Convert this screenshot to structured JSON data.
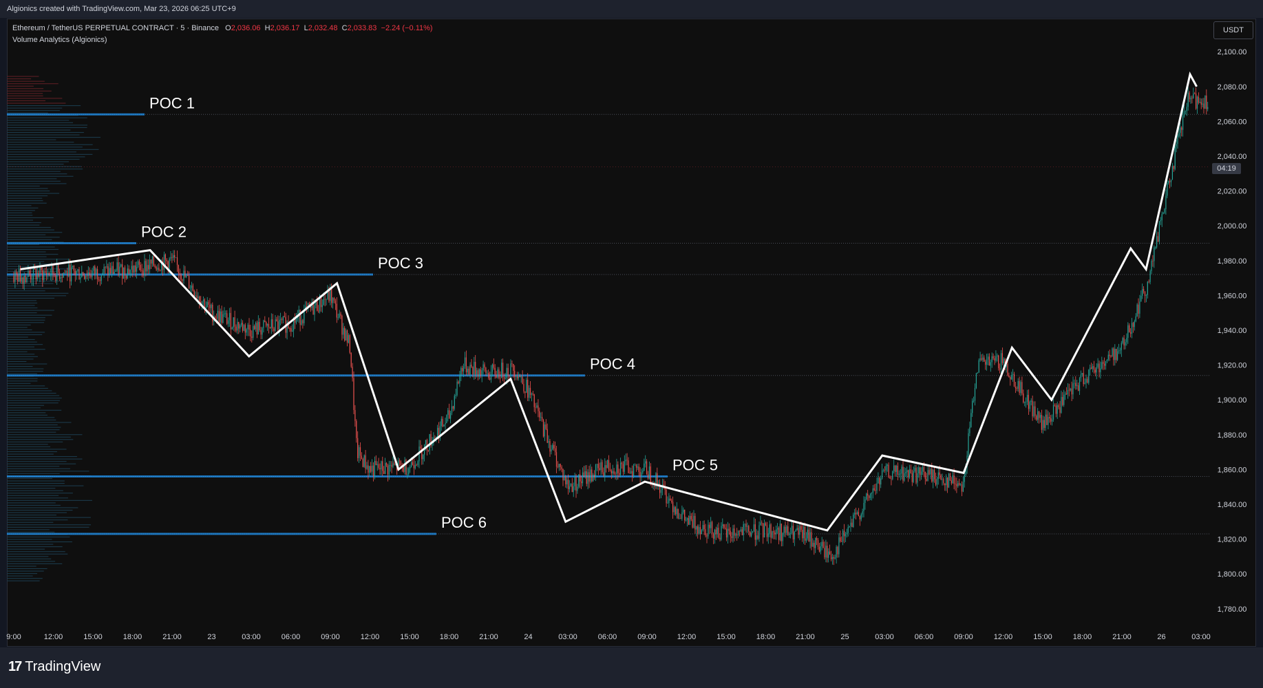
{
  "header": {
    "caption": "Algionics created with TradingView.com, Mar 23, 2026 06:25 UTC+9"
  },
  "legend": {
    "symbol": "Ethereum / TetherUS PERPETUAL CONTRACT · 5 · Binance",
    "o_label": "O",
    "o_value": "2,036.06",
    "h_label": "H",
    "h_value": "2,036.17",
    "l_label": "L",
    "l_value": "2,032.48",
    "c_label": "C",
    "c_value": "2,033.83",
    "change": "−2.24 (−0.11%)",
    "indicator": "Volume Analytics (Algionics)"
  },
  "currency_button": "USDT",
  "countdown": "04:19",
  "footer": {
    "brand": "TradingView",
    "logo_glyph": "17"
  },
  "colors": {
    "background": "#0f0f0f",
    "up": "#26a69a",
    "down": "#ef5350",
    "profile": "#2196f3",
    "zigzag": "#ffffff",
    "poc_line": "#2196f3"
  },
  "chart_data": {
    "type": "line",
    "title": "",
    "y_ticks": [
      "2,100.00",
      "2,080.00",
      "2,060.00",
      "2,040.00",
      "2,020.00",
      "2,000.00",
      "1,980.00",
      "1,960.00",
      "1,940.00",
      "1,920.00",
      "1,900.00",
      "1,880.00",
      "1,860.00",
      "1,840.00",
      "1,820.00",
      "1,800.00",
      "1,780.00"
    ],
    "ylim": [
      1772,
      2106
    ],
    "x_ticks": [
      "9:00",
      "12:00",
      "15:00",
      "18:00",
      "21:00",
      "23",
      "03:00",
      "06:00",
      "09:00",
      "12:00",
      "15:00",
      "18:00",
      "21:00",
      "24",
      "03:00",
      "06:00",
      "09:00",
      "12:00",
      "15:00",
      "18:00",
      "21:00",
      "25",
      "03:00",
      "06:00",
      "09:00",
      "12:00",
      "15:00",
      "18:00",
      "21:00",
      "26",
      "03:00"
    ],
    "x_start": "Mar 22 09:00",
    "x_end": "Mar 26 03:00",
    "last_price": 2033.83,
    "poc_levels": [
      {
        "label": "POC 1",
        "price": 2064
      },
      {
        "label": "POC 2",
        "price": 1990
      },
      {
        "label": "POC 3",
        "price": 1972
      },
      {
        "label": "POC 4",
        "price": 1914
      },
      {
        "label": "POC 5",
        "price": 1856
      },
      {
        "label": "POC 6",
        "price": 1823
      }
    ],
    "zigzag": {
      "name": "",
      "points": [
        {
          "t": "Mar 22 09:30",
          "p": 1975
        },
        {
          "t": "Mar 22 19:20",
          "p": 1986
        },
        {
          "t": "Mar 23 02:50",
          "p": 1925
        },
        {
          "t": "Mar 23 09:30",
          "p": 1967
        },
        {
          "t": "Mar 23 14:10",
          "p": 1860
        },
        {
          "t": "Mar 23 22:40",
          "p": 1912
        },
        {
          "t": "Mar 24 02:50",
          "p": 1830
        },
        {
          "t": "Mar 24 08:50",
          "p": 1853
        },
        {
          "t": "Mar 24 22:40",
          "p": 1825
        },
        {
          "t": "Mar 25 02:50",
          "p": 1868
        },
        {
          "t": "Mar 25 09:00",
          "p": 1858
        },
        {
          "t": "Mar 25 12:40",
          "p": 1930
        },
        {
          "t": "Mar 25 15:40",
          "p": 1900
        },
        {
          "t": "Mar 25 21:40",
          "p": 1987
        },
        {
          "t": "Mar 25 22:50",
          "p": 1975
        },
        {
          "t": "Mar 26 02:10",
          "p": 2087
        },
        {
          "t": "Mar 26 02:40",
          "p": 2080
        }
      ]
    },
    "price_path": [
      {
        "t": "Mar 22 09:00",
        "p": 1971
      },
      {
        "t": "Mar 22 12:00",
        "p": 1973
      },
      {
        "t": "Mar 22 15:00",
        "p": 1973
      },
      {
        "t": "Mar 22 18:00",
        "p": 1975
      },
      {
        "t": "Mar 22 21:00",
        "p": 1980
      },
      {
        "t": "Mar 23 00:00",
        "p": 1950
      },
      {
        "t": "Mar 23 03:00",
        "p": 1940
      },
      {
        "t": "Mar 23 06:00",
        "p": 1944
      },
      {
        "t": "Mar 23 09:00",
        "p": 1960
      },
      {
        "t": "Mar 23 10:30",
        "p": 1930
      },
      {
        "t": "Mar 23 11:00",
        "p": 1870
      },
      {
        "t": "Mar 23 12:00",
        "p": 1860
      },
      {
        "t": "Mar 23 15:00",
        "p": 1862
      },
      {
        "t": "Mar 23 18:00",
        "p": 1890
      },
      {
        "t": "Mar 23 19:00",
        "p": 1920
      },
      {
        "t": "Mar 23 21:00",
        "p": 1915
      },
      {
        "t": "Mar 23 23:00",
        "p": 1918
      },
      {
        "t": "Mar 24 00:00",
        "p": 1905
      },
      {
        "t": "Mar 24 03:00",
        "p": 1850
      },
      {
        "t": "Mar 24 06:00",
        "p": 1862
      },
      {
        "t": "Mar 24 09:00",
        "p": 1860
      },
      {
        "t": "Mar 24 12:00",
        "p": 1830
      },
      {
        "t": "Mar 24 15:00",
        "p": 1823
      },
      {
        "t": "Mar 24 18:00",
        "p": 1825
      },
      {
        "t": "Mar 24 21:00",
        "p": 1822
      },
      {
        "t": "Mar 24 23:00",
        "p": 1810
      },
      {
        "t": "Mar 25 03:00",
        "p": 1858
      },
      {
        "t": "Mar 25 06:00",
        "p": 1857
      },
      {
        "t": "Mar 25 09:00",
        "p": 1852
      },
      {
        "t": "Mar 25 10:00",
        "p": 1920
      },
      {
        "t": "Mar 25 12:00",
        "p": 1922
      },
      {
        "t": "Mar 25 15:00",
        "p": 1885
      },
      {
        "t": "Mar 25 18:00",
        "p": 1912
      },
      {
        "t": "Mar 25 21:00",
        "p": 1930
      },
      {
        "t": "Mar 25 23:00",
        "p": 1968
      },
      {
        "t": "Mar 26 01:00",
        "p": 2040
      },
      {
        "t": "Mar 26 02:00",
        "p": 2072
      },
      {
        "t": "Mar 26 03:00",
        "p": 2072
      }
    ],
    "grid": false
  }
}
